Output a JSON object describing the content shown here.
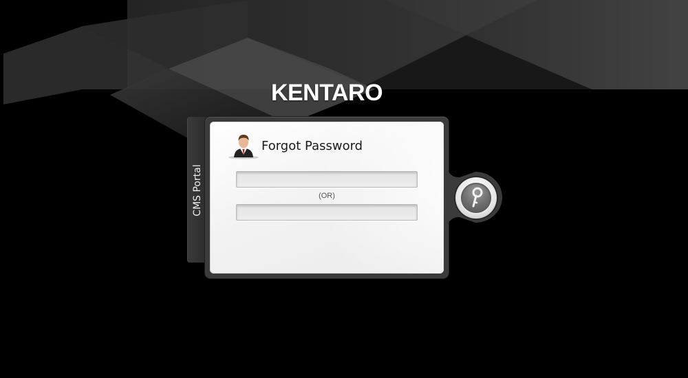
{
  "brand": {
    "name": "KENTARO"
  },
  "side_tab": {
    "label": "CMS Portal"
  },
  "form": {
    "title": "Forgot Password",
    "field_1": {
      "value": "",
      "placeholder": ""
    },
    "separator": "(OR)",
    "field_2": {
      "value": "",
      "placeholder": ""
    }
  },
  "icons": {
    "user": "user-avatar-icon",
    "submit": "key-icon"
  },
  "colors": {
    "background": "#000000",
    "card": "#f2f2f2",
    "frame": "#3b3b3b",
    "brand_text": "#ffffff"
  }
}
